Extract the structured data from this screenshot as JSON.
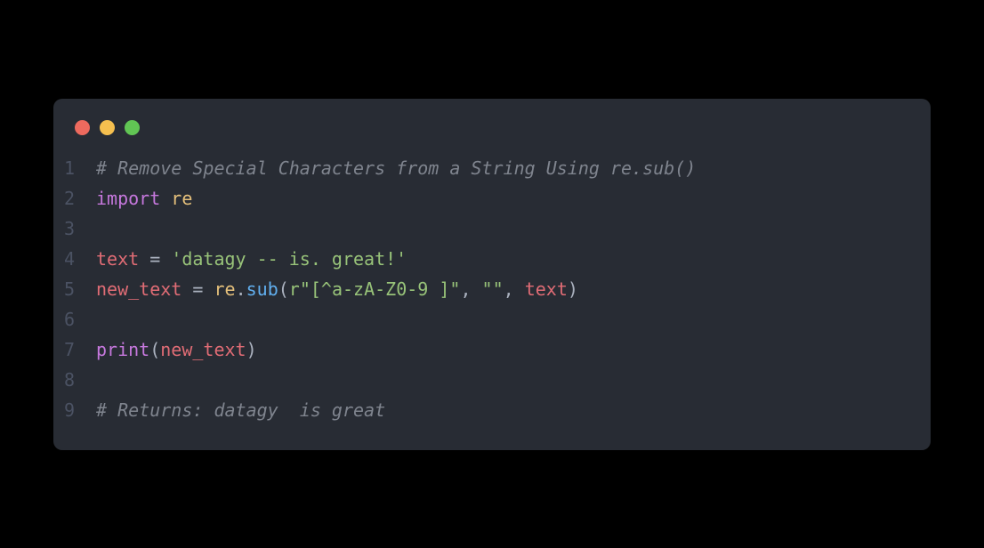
{
  "traffic_lights": {
    "red": "red",
    "yellow": "yellow",
    "green": "green"
  },
  "code": {
    "lines": [
      {
        "num": "1",
        "tokens": [
          {
            "cls": "comment",
            "text": "# Remove Special Characters from a String Using re.sub()"
          }
        ]
      },
      {
        "num": "2",
        "tokens": [
          {
            "cls": "keyword",
            "text": "import"
          },
          {
            "cls": "",
            "text": " "
          },
          {
            "cls": "module",
            "text": "re"
          }
        ]
      },
      {
        "num": "3",
        "tokens": []
      },
      {
        "num": "4",
        "tokens": [
          {
            "cls": "variable",
            "text": "text"
          },
          {
            "cls": "",
            "text": " "
          },
          {
            "cls": "operator",
            "text": "="
          },
          {
            "cls": "",
            "text": " "
          },
          {
            "cls": "string",
            "text": "'datagy -- is. great!'"
          }
        ]
      },
      {
        "num": "5",
        "tokens": [
          {
            "cls": "variable",
            "text": "new_text"
          },
          {
            "cls": "",
            "text": " "
          },
          {
            "cls": "operator",
            "text": "="
          },
          {
            "cls": "",
            "text": " "
          },
          {
            "cls": "module",
            "text": "re"
          },
          {
            "cls": "",
            "text": "."
          },
          {
            "cls": "method",
            "text": "sub"
          },
          {
            "cls": "paren",
            "text": "("
          },
          {
            "cls": "string",
            "text": "r\"[^a-zA-Z0-9 ]\""
          },
          {
            "cls": "",
            "text": ", "
          },
          {
            "cls": "string",
            "text": "\"\""
          },
          {
            "cls": "",
            "text": ", "
          },
          {
            "cls": "variable",
            "text": "text"
          },
          {
            "cls": "paren",
            "text": ")"
          }
        ]
      },
      {
        "num": "6",
        "tokens": []
      },
      {
        "num": "7",
        "tokens": [
          {
            "cls": "builtin",
            "text": "print"
          },
          {
            "cls": "paren",
            "text": "("
          },
          {
            "cls": "variable",
            "text": "new_text"
          },
          {
            "cls": "paren",
            "text": ")"
          }
        ]
      },
      {
        "num": "8",
        "tokens": []
      },
      {
        "num": "9",
        "tokens": [
          {
            "cls": "comment",
            "text": "# Returns: datagy  is great"
          }
        ]
      }
    ]
  }
}
